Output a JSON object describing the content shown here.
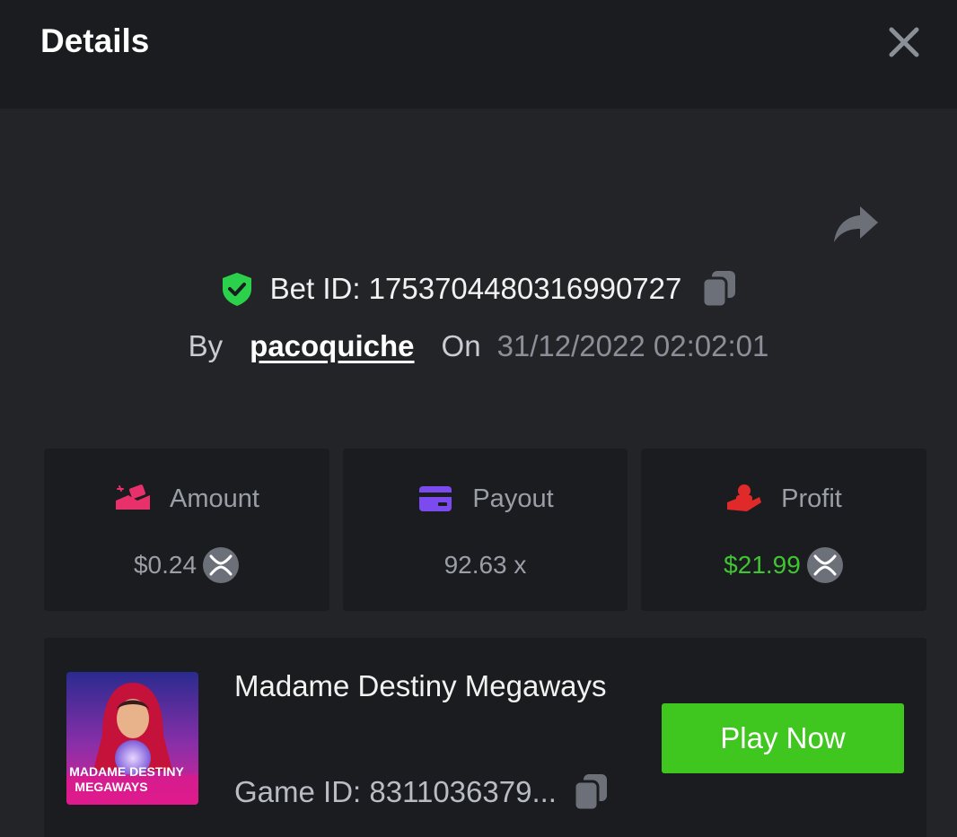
{
  "header": {
    "title": "Details"
  },
  "bet": {
    "id_text": "Bet ID: 1753704480316990727",
    "by_label": "By",
    "username": "pacoquiche",
    "on_label": "On",
    "datetime": "31/12/2022 02:02:01"
  },
  "stats": [
    {
      "label": "Amount",
      "value": "$0.24",
      "icon": "hand-coins-icon",
      "color": "#e8306b"
    },
    {
      "label": "Payout",
      "value": "92.63 x",
      "icon": "credit-card-icon",
      "color": "#7b4bf0"
    },
    {
      "label": "Profit",
      "value": "$21.99",
      "icon": "hand-money-icon",
      "color": "#e02a2a",
      "value_color": "#3fc531"
    }
  ],
  "game": {
    "name": "Madame Destiny Megaways",
    "id_text": "Game ID: 8311036379...",
    "thumb_title_line1": "MADAME DESTINY",
    "thumb_title_line2": "MEGAWAYS",
    "play_label": "Play Now"
  },
  "colors": {
    "accent_green": "#3fc61f",
    "shield_green": "#2bd14a",
    "panel": "#1b1c1f",
    "background": "#232427"
  }
}
